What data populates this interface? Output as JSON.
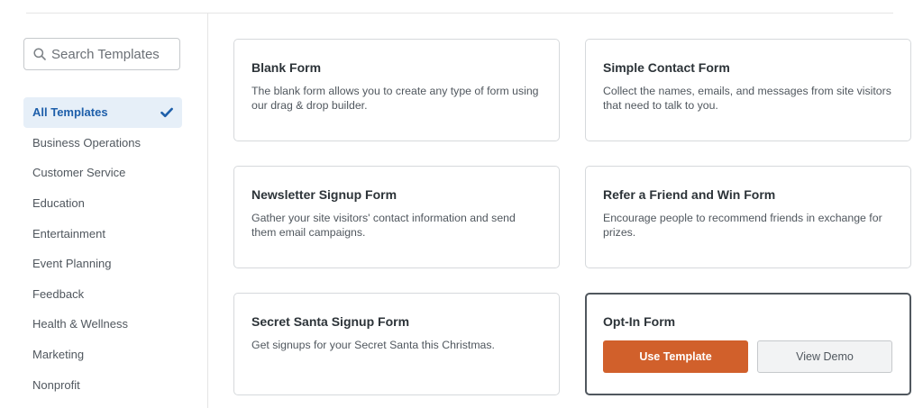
{
  "search": {
    "placeholder": "Search Templates"
  },
  "categories": [
    {
      "label": "All Templates",
      "active": true
    },
    {
      "label": "Business Operations"
    },
    {
      "label": "Customer Service"
    },
    {
      "label": "Education"
    },
    {
      "label": "Entertainment"
    },
    {
      "label": "Event Planning"
    },
    {
      "label": "Feedback"
    },
    {
      "label": "Health & Wellness"
    },
    {
      "label": "Marketing"
    },
    {
      "label": "Nonprofit"
    }
  ],
  "templates": [
    {
      "title": "Blank Form",
      "description": "The blank form allows you to create any type of form using our drag & drop builder."
    },
    {
      "title": "Simple Contact Form",
      "description": "Collect the names, emails, and messages from site visitors that need to talk to you."
    },
    {
      "title": "Newsletter Signup Form",
      "description": "Gather your site visitors' contact information and send them email campaigns."
    },
    {
      "title": "Refer a Friend and Win Form",
      "description": "Encourage people to recommend friends in exchange for prizes."
    },
    {
      "title": "Secret Santa Signup Form",
      "description": "Get signups for your Secret Santa this Christmas."
    },
    {
      "title": "Opt-In Form",
      "use_label": "Use Template",
      "demo_label": "View Demo"
    }
  ],
  "colors": {
    "accent": "#d1602b",
    "active_bg": "#e6eff8",
    "active_text": "#1e5faa"
  }
}
